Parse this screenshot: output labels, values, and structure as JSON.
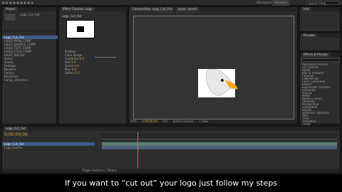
{
  "menu": {
    "app_label": "",
    "workspace_label": "Workspace:",
    "workspace_value": "Standard",
    "search_placeholder": "Search Help"
  },
  "project": {
    "tabs": [
      "Project",
      "Effect Controls: Logo"
    ],
    "selected_item": "Logo_Cut_Out",
    "items": [
      "Logo_Cut_Out",
      "LOGO_MAIN_COMP",
      "LOGO_SOURCE_COMP",
      "LOGO_TEXT_COMP",
      "LOGO_TITLE_COMP",
      "LOGO_SOLIDS",
      "Solids",
      "Assets",
      "Footage",
      "Renders",
      "Comps",
      "Precomps",
      "Comp_reference"
    ]
  },
  "effects_panel": {
    "title": "Logo_Cut_Out",
    "properties": [
      {
        "name": "Position",
        "value": ""
      },
      {
        "name": "Color Range",
        "value": ""
      },
      {
        "name": "Fuzziness",
        "value": "0.0"
      },
      {
        "name": "Red",
        "value": "0.0"
      },
      {
        "name": "Green",
        "value": "0.0"
      },
      {
        "name": "Blue",
        "value": "0.0"
      },
      {
        "name": "Soften",
        "value": "0.0"
      }
    ]
  },
  "composition": {
    "tabs": [
      "Composition: Logo_Cut_Out",
      "Layer: (none)"
    ],
    "zoom": "50%",
    "timecode": "0;00;00;00",
    "resolution": "Full",
    "view": "Active Camera",
    "views": "1 View"
  },
  "right_panel": {
    "top_title": "Info",
    "preview_title": "Preview",
    "effects_title": "Effects & Presets",
    "search_placeholder": "",
    "effect_categories": [
      "Animation Presets",
      "3D Channel",
      "Audio",
      "Blur & Sharpen",
      "Channel",
      "CINEMA 4D",
      "Color Correction",
      "Distort",
      "Expression Controls",
      "Generate",
      "Keying",
      "Matte",
      "Noise & Grain",
      "Obsolete",
      "Perspective",
      "Simulation",
      "Stylize",
      "Synthetic Aperture",
      "Text",
      "Time",
      "Transition",
      "Utility"
    ]
  },
  "timeline": {
    "tab_label": "Logo_Cut_Out",
    "timecode": "0;00;00;00",
    "layers": [
      "Logo_Cut_Out",
      "Logo_Source"
    ],
    "toggle_label": "Toggle Switches / Modes"
  },
  "caption": {
    "text": "If you want to “cut out” your logo just follow my steps"
  },
  "colors": {
    "accent": "#3d5a8a",
    "timecode": "#d9a63a",
    "layer_bar": "#5d7a6e",
    "layer_bar2": "#4d5f7a"
  },
  "icons": [
    "eagle-logo-icon",
    "solid-thumbnail-icon",
    "timecode-icon",
    "zoom-icon",
    "camera-icon"
  ]
}
